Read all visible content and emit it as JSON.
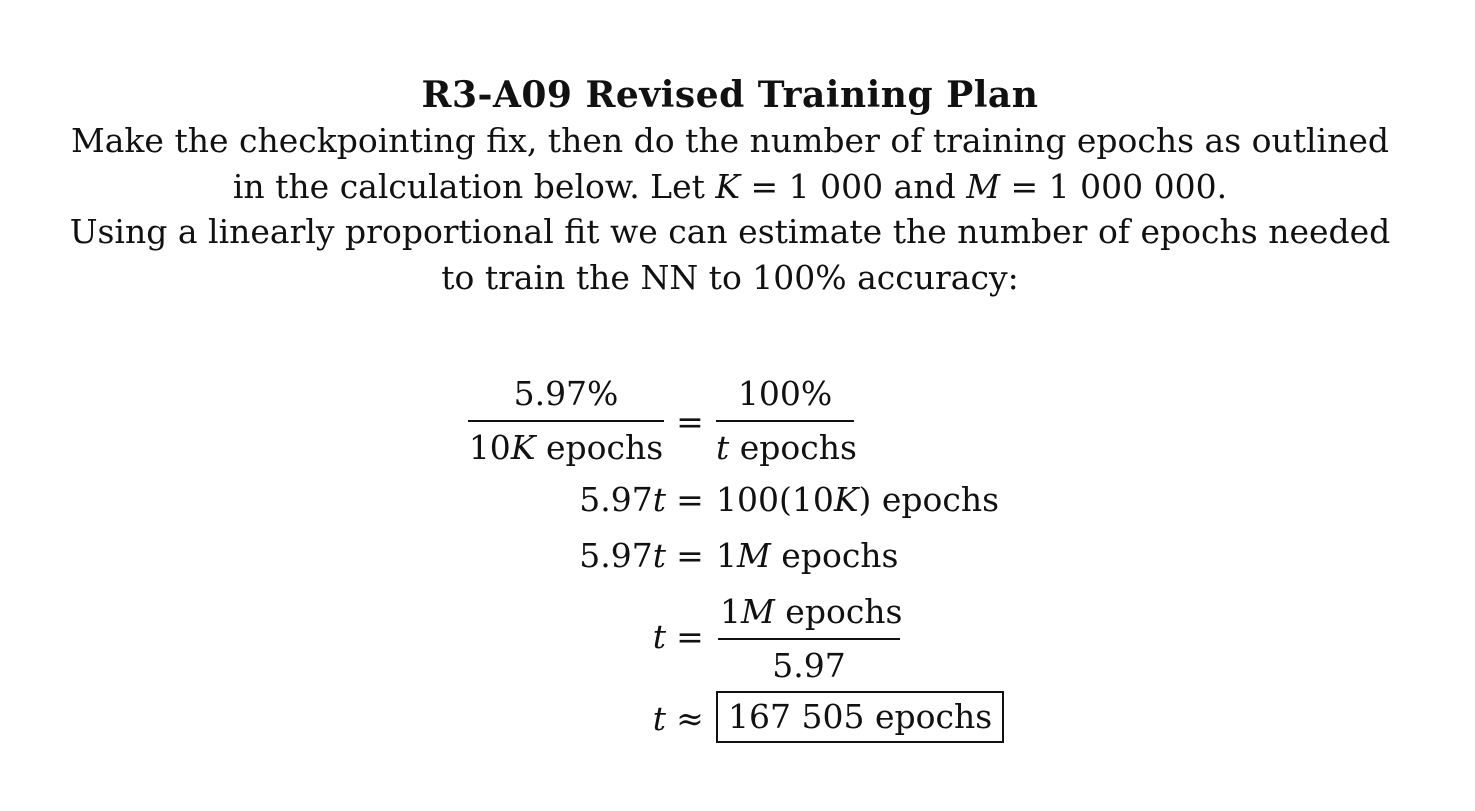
{
  "title": "R3-A09 Revised Training Plan",
  "paragraph1": {
    "line1": "Make the checkpointing fix, then do the number of training epochs as outlined",
    "line2_prefix": "in the calculation below. Let",
    "var_k": "K",
    "k_value": "= 1 000",
    "and": "and",
    "var_m": "M",
    "m_value": "= 1 000 000."
  },
  "paragraph2": {
    "line1": "Using a linearly proportional fit we can estimate the number of epochs needed",
    "line2": "to train the NN to 100% accuracy:"
  },
  "equations": {
    "eq1": {
      "lhs_num": "5.97%",
      "lhs_den_coef": "10",
      "lhs_den_var": "K",
      "lhs_den_unit": "epochs",
      "rel": "=",
      "rhs_num": "100%",
      "rhs_den_var": "t",
      "rhs_den_unit": "epochs"
    },
    "eq2": {
      "lhs_coef": "5.97",
      "lhs_var": "t",
      "rel": "=",
      "rhs_a": "100(10",
      "rhs_var": "K",
      "rhs_b": ")",
      "rhs_unit": "epochs"
    },
    "eq3": {
      "lhs_coef": "5.97",
      "lhs_var": "t",
      "rel": "=",
      "rhs_coef": "1",
      "rhs_var": "M",
      "rhs_unit": "epochs"
    },
    "eq4": {
      "lhs_var": "t",
      "rel": "=",
      "num_coef": "1",
      "num_var": "M",
      "num_unit": "epochs",
      "den": "5.97"
    },
    "eq5": {
      "lhs_var": "t",
      "rel": "≈",
      "result": "167 505 epochs"
    }
  }
}
